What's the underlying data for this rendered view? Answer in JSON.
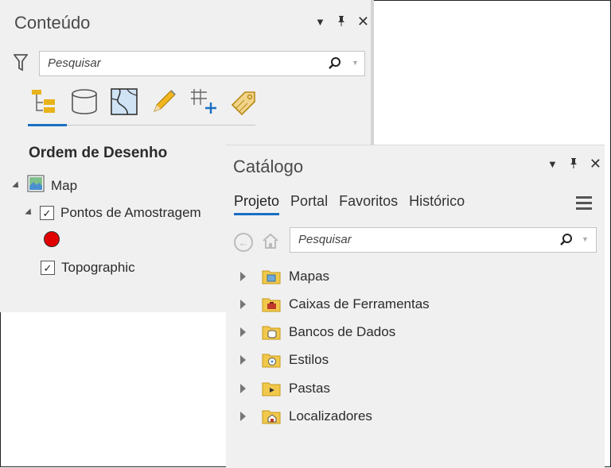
{
  "contents": {
    "title": "Conteúdo",
    "search_placeholder": "Pesquisar",
    "section_title": "Ordem de Desenho",
    "tree": {
      "map_label": "Map",
      "layer1_label": "Pontos de Amostragem",
      "layer2_label": "Topographic",
      "point_color": "#e00000"
    }
  },
  "catalog": {
    "title": "Catálogo",
    "tabs": [
      "Projeto",
      "Portal",
      "Favoritos",
      "Histórico"
    ],
    "active_tab": "Projeto",
    "search_placeholder": "Pesquisar",
    "items": [
      "Mapas",
      "Caixas de Ferramentas",
      "Bancos de Dados",
      "Estilos",
      "Pastas",
      "Localizadores"
    ]
  },
  "colors": {
    "accent": "#1a6fc2",
    "folder": "#f1c84b",
    "pane_bg": "#f0f0f0"
  },
  "icons": {
    "pane_controls": [
      "dropdown-icon",
      "pin-icon",
      "close-icon"
    ],
    "contents_tools": [
      "list-by-drawing-order-icon",
      "list-by-data-source-icon",
      "list-by-selection-icon",
      "list-by-editing-icon",
      "list-by-snapping-icon",
      "list-by-labeling-icon"
    ]
  }
}
